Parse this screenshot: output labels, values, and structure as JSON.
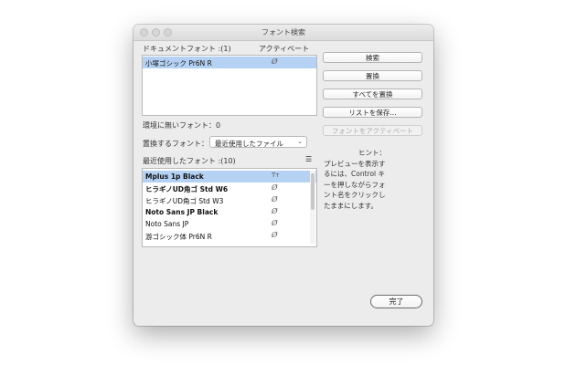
{
  "window": {
    "title": "フォント検索"
  },
  "document_fonts": {
    "label": "ドキュメントフォント :(1)",
    "active_header": "アクティベート",
    "items": [
      {
        "name": "小塚ゴシック Pr6N R",
        "icon": "Ø",
        "selected": true
      }
    ]
  },
  "missing_fonts_label": "環境に無いフォント：0",
  "replace": {
    "label": "置換するフォント：",
    "selected": "最近使用したファイル"
  },
  "recent_fonts": {
    "label": "最近使用したフォント :(10)",
    "items": [
      {
        "name": "Mplus 1p Black",
        "icon": "Tт",
        "selected": true,
        "bold": true
      },
      {
        "name": "ヒラギノUD角ゴ Std W6",
        "icon": "Ø",
        "bold": true
      },
      {
        "name": "ヒラギノUD角ゴ Std W3",
        "icon": "Ø"
      },
      {
        "name": "Noto Sans JP Black",
        "icon": "Ø",
        "bold": true
      },
      {
        "name": "Noto Sans JP",
        "icon": "Ø"
      },
      {
        "name": "游ゴシック体 Pr6N R",
        "icon": "Ø"
      }
    ]
  },
  "buttons": {
    "search": "検索",
    "replace": "置換",
    "replace_all": "すべてを置換",
    "save_list": "リストを保存...",
    "activate_font": "フォントをアクティベート"
  },
  "hint": {
    "title": "ヒント：",
    "lines": [
      "プレビューを表示す",
      "るには、Control キ",
      "ーを押しながらフォ",
      "ント名をクリックし",
      "たままにします。"
    ]
  },
  "done_button": "完了"
}
